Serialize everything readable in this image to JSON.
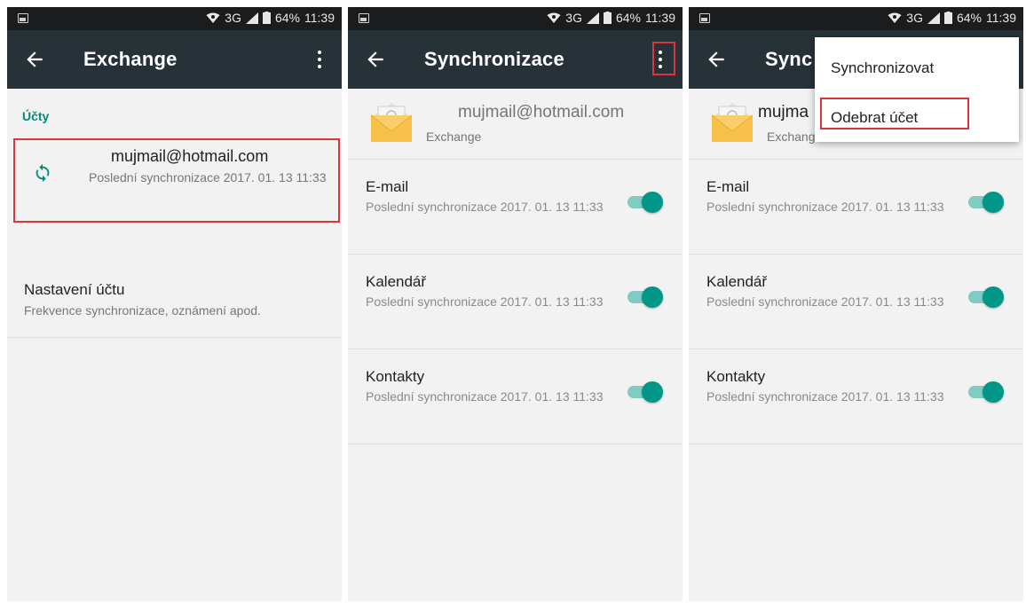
{
  "status_bar": {
    "network": "3G",
    "battery": "64%",
    "time": "11:39"
  },
  "panel1": {
    "toolbar_title": "Exchange",
    "section_label": "Účty",
    "account": {
      "email": "mujmail@hotmail.com",
      "last_sync": "Poslední synchronizace 2017. 01. 13 11:33"
    },
    "settings": {
      "title": "Nastavení účtu",
      "subtitle": "Frekvence synchronizace, oznámení apod."
    }
  },
  "panel2": {
    "toolbar_title": "Synchronizace",
    "account_email": "mujmail@hotmail.com",
    "account_type": "Exchange",
    "items": [
      {
        "label": "E-mail",
        "last_sync": "Poslední synchronizace 2017. 01. 13 11:33",
        "enabled": true
      },
      {
        "label": "Kalendář",
        "last_sync": "Poslední synchronizace 2017. 01. 13 11:33",
        "enabled": true
      },
      {
        "label": "Kontakty",
        "last_sync": "Poslední synchronizace 2017. 01. 13 11:33",
        "enabled": true
      }
    ]
  },
  "panel3": {
    "toolbar_title_visible": "Sync",
    "account_email_visible": "mujma",
    "account_type": "Exchange",
    "menu": {
      "sync_now": "Synchronizovat",
      "remove_account": "Odebrat účet"
    },
    "items": [
      {
        "label": "E-mail",
        "last_sync": "Poslední synchronizace 2017. 01. 13 11:33",
        "enabled": true
      },
      {
        "label": "Kalendář",
        "last_sync": "Poslední synchronizace 2017. 01. 13 11:33",
        "enabled": true
      },
      {
        "label": "Kontakty",
        "last_sync": "Poslední synchronizace 2017. 01. 13 11:33",
        "enabled": true
      }
    ]
  },
  "colors": {
    "toolbar": "#263238",
    "status_bar": "#1a1c1d",
    "accent": "#009688",
    "highlight_box": "#d6363c"
  }
}
